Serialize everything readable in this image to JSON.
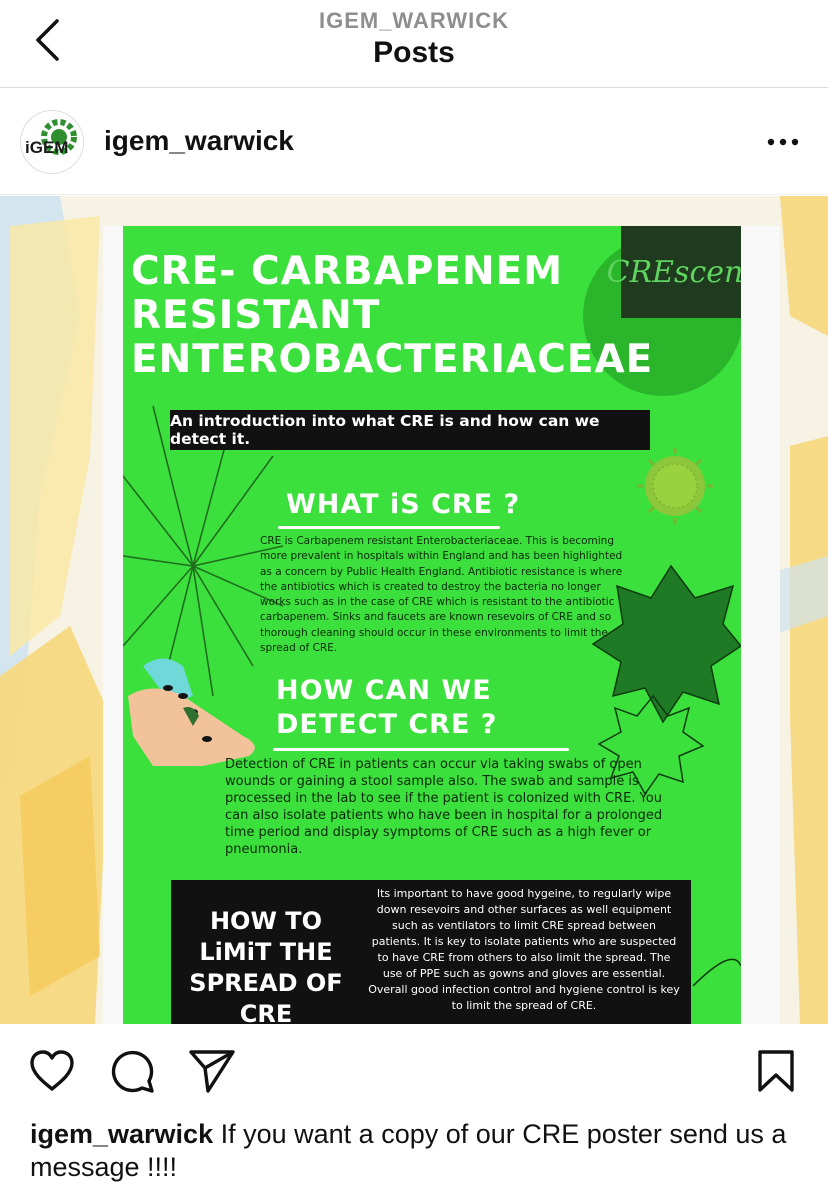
{
  "nav": {
    "handle": "IGEM_WARWICK",
    "title": "Posts",
    "back_icon": "chevron-left-icon"
  },
  "post": {
    "username": "igem_warwick",
    "avatar_text": "iGEM",
    "more_icon": "more-horizontal-icon"
  },
  "poster": {
    "title": "CRE- CARBAPENEM RESISTANT ENTEROBACTERIACEAE",
    "logo_text": "CREscent",
    "intro": "An introduction into what CRE is and how can we detect it.",
    "what_heading": "WHAT iS CRE ?",
    "what_text": "CRE is Carbapenem resistant Enterobacteriaceae. This is becoming more prevalent in hospitals within England and has been highlighted as a concern by Public Health England. Antibiotic resistance is where the antibiotics which is created to destroy the bacteria no longer works such as in the case of CRE which is resistant to the antibiotic carbapenem. Sinks and faucets are known resevoirs of CRE and so thorough cleaning should occur in these environments to limit the spread of CRE.",
    "detect_heading": "HOW CAN WE DETECT CRE ?",
    "detect_text": "Detection of CRE in patients can occur via taking swabs of open wounds or gaining a stool sample also. The swab and sample is processed in the lab to see if the patient is colonized with CRE. You can also isolate patients who have been in hospital for a prolonged time period and display symptoms of CRE such as a high fever or pneumonia.",
    "limit_heading": "HOW TO LiMiT THE SPREAD OF CRE",
    "limit_text": "Its important to have good hygeine, to regularly wipe down resevoirs and other surfaces as well equipment such as ventilators to limit CRE spread between patients. It is key to isolate patients who are suspected to have CRE from others to also limit the spread. The use of PPE such as gowns and gloves are essential. Overall good infection control and hygiene control is key to limit the spread of CRE.",
    "colors": {
      "poster_green": "#3ce03c",
      "dark": "#111111"
    }
  },
  "actions": {
    "like_icon": "heart-icon",
    "comment_icon": "comment-icon",
    "share_icon": "send-icon",
    "save_icon": "bookmark-icon"
  },
  "caption": {
    "username": "igem_warwick",
    "text": "If you want a copy of our CRE poster send us a message !!!!"
  }
}
